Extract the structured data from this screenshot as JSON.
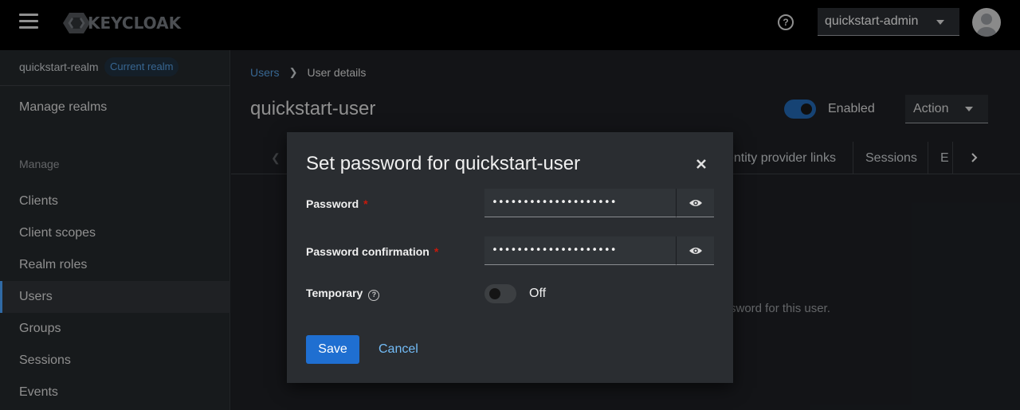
{
  "header": {
    "logo_text": "KEYCLOAK",
    "user_menu": "quickstart-admin"
  },
  "sidebar": {
    "realm_name": "quickstart-realm",
    "realm_badge": "Current realm",
    "manage_realms": "Manage realms",
    "section_manage": "Manage",
    "items": [
      {
        "label": "Clients"
      },
      {
        "label": "Client scopes"
      },
      {
        "label": "Realm roles"
      },
      {
        "label": "Users"
      },
      {
        "label": "Groups"
      },
      {
        "label": "Sessions"
      },
      {
        "label": "Events"
      }
    ],
    "active_item": "Users"
  },
  "main": {
    "breadcrumb": {
      "parent": "Users",
      "current": "User details"
    },
    "title": "quickstart-user",
    "enabled_label": "Enabled",
    "action_label": "Action",
    "tabs": [
      {
        "label": "entity provider links"
      },
      {
        "label": "Sessions"
      },
      {
        "label": "E"
      }
    ],
    "background_text": "sword for this user."
  },
  "modal": {
    "title": "Set password for quickstart-user",
    "password_label": "Password",
    "password_value": "••••••••••••••••••••",
    "confirm_label": "Password confirmation",
    "confirm_value": "••••••••••••••••••••",
    "required_mark": "*",
    "temporary_label": "Temporary",
    "temporary_state": "Off",
    "save_label": "Save",
    "cancel_label": "Cancel"
  },
  "colors": {
    "accent": "#1f6fd1",
    "link": "#73bcf7",
    "required": "#c9190b"
  }
}
